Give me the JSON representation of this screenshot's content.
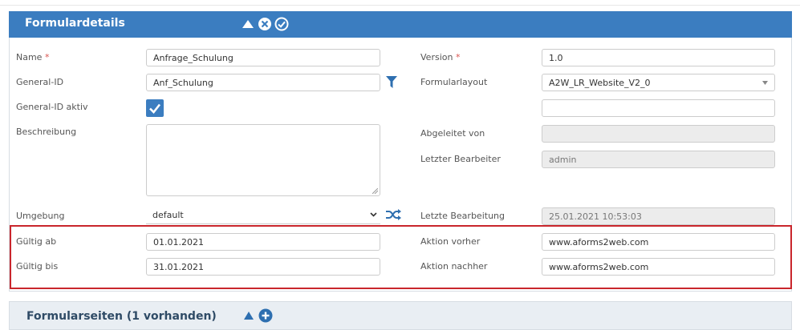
{
  "panel": {
    "title": "Formulardetails",
    "icons": [
      "collapse-up-icon",
      "close-circle-icon",
      "check-circle-icon"
    ]
  },
  "left": {
    "name_label": "Name",
    "name_required": "*",
    "name_value": "Anfrage_Schulung",
    "general_id_label": "General-ID",
    "general_id_value": "Anf_Schulung",
    "general_id_active_label": "General-ID aktiv",
    "general_id_active_checked": true,
    "description_label": "Beschreibung",
    "description_value": "",
    "environment_label": "Umgebung",
    "environment_value": "default",
    "valid_from_label": "Gültig ab",
    "valid_from_value": "01.01.2021",
    "valid_to_label": "Gültig bis",
    "valid_to_value": "31.01.2021"
  },
  "right": {
    "version_label": "Version",
    "version_required": "*",
    "version_value": "1.0",
    "layout_label": "Formularlayout",
    "layout_value": "A2W_LR_Website_V2_0",
    "extra_value": "",
    "derived_label": "Abgeleitet von",
    "derived_value": "",
    "last_editor_label": "Letzter Bearbeiter",
    "last_editor_value": "admin",
    "last_edit_label": "Letzte Bearbeitung",
    "last_edit_value": "25.01.2021 10:53:03",
    "action_before_label": "Aktion vorher",
    "action_before_value": "www.aforms2web.com",
    "action_after_label": "Aktion nachher",
    "action_after_value": "www.aforms2web.com"
  },
  "pages_section": {
    "title": "Formularseiten (1 vorhanden)",
    "icons": [
      "collapse-up-icon",
      "add-circle-icon"
    ]
  },
  "colors": {
    "header": "#3b7dc0",
    "highlight": "#c9262c"
  }
}
